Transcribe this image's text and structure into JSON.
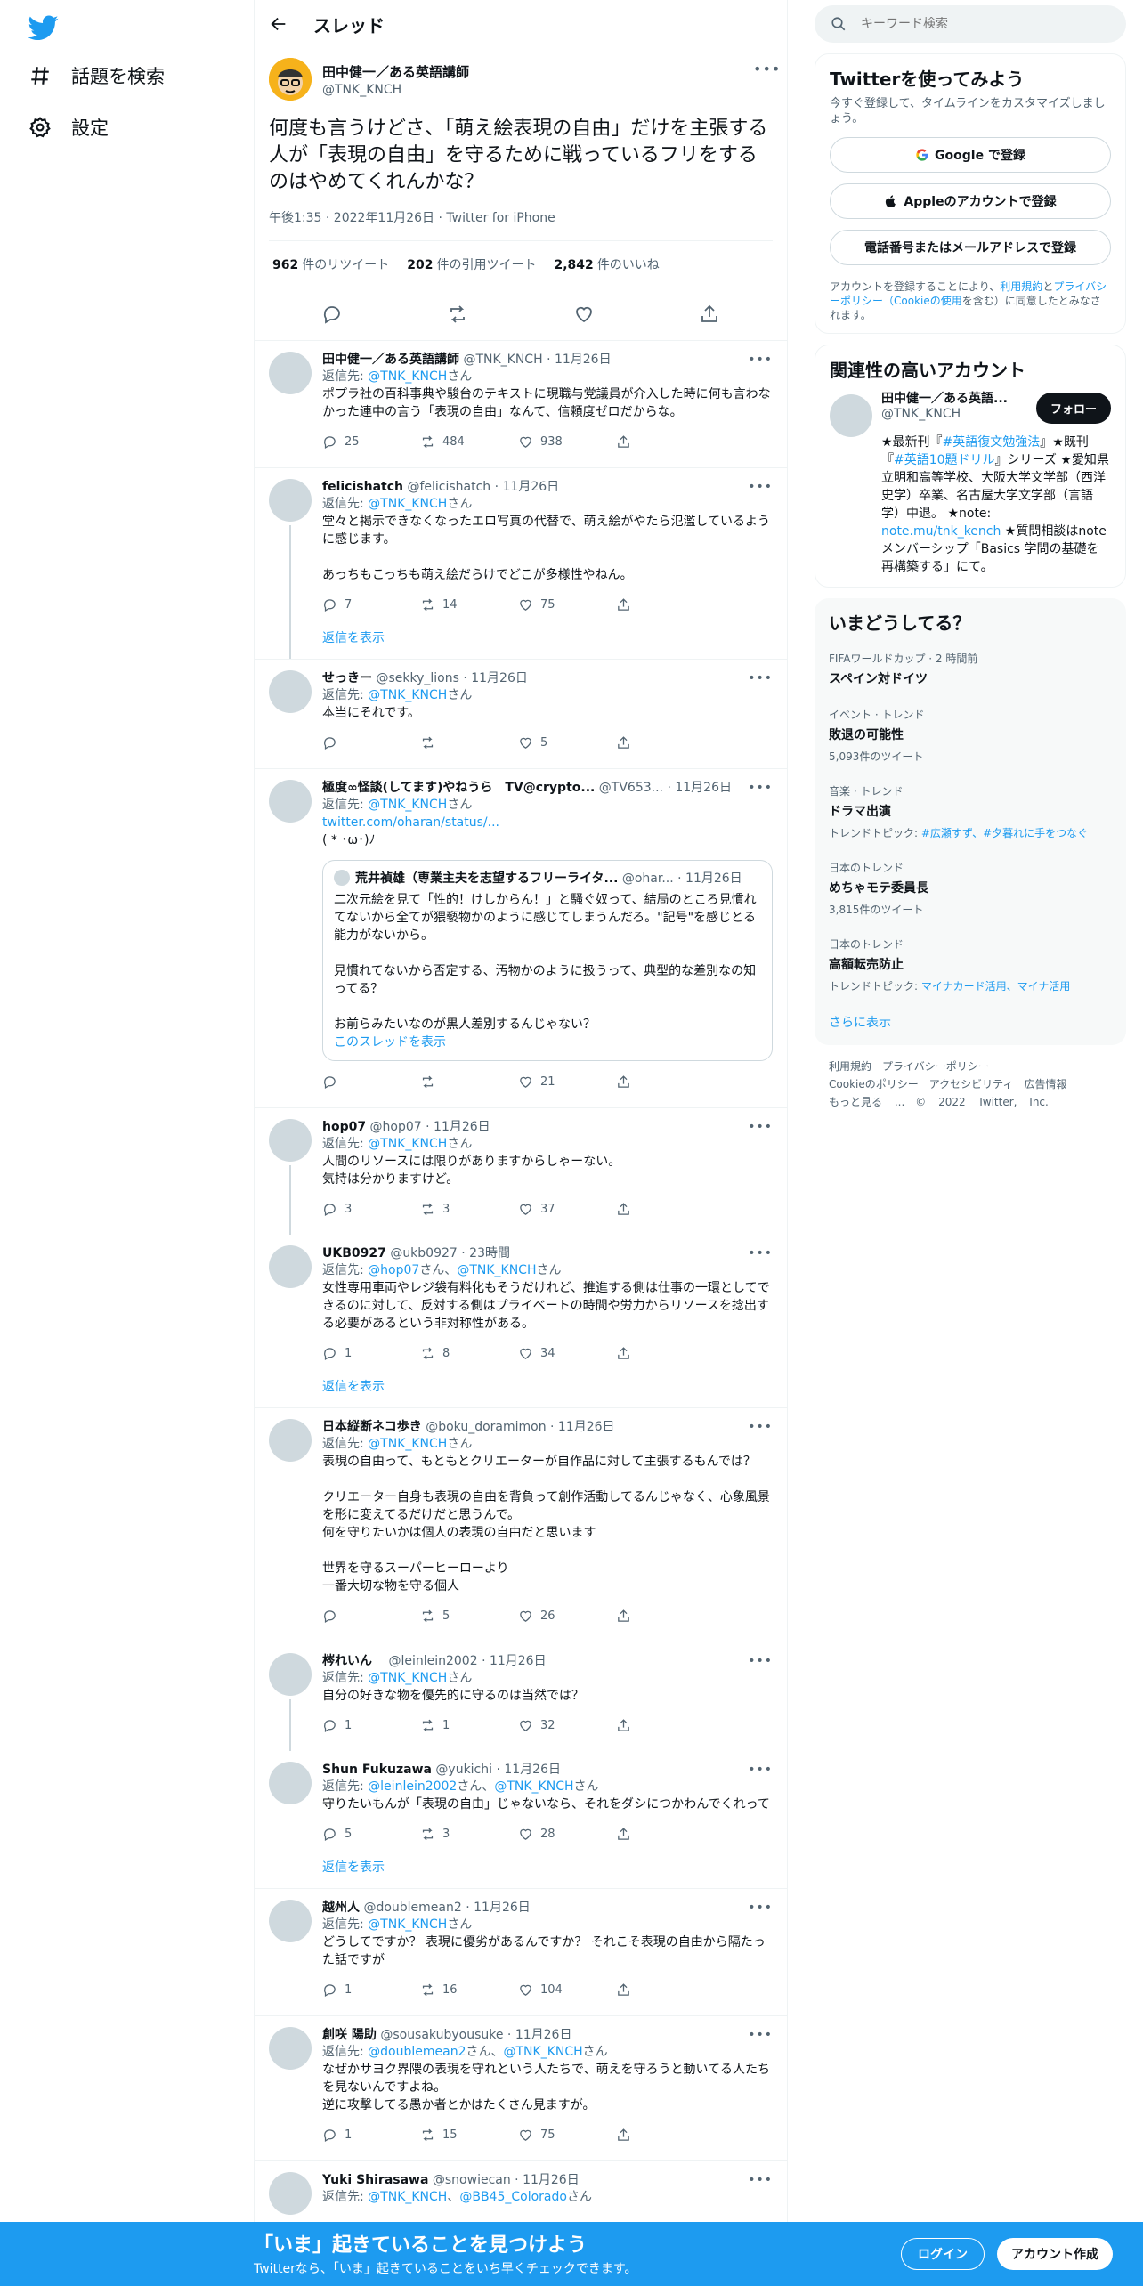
{
  "nav": {
    "explore_label": "話題を検索",
    "settings_label": "設定"
  },
  "header": {
    "title": "スレッド"
  },
  "main_tweet": {
    "name": "田中健一／ある英語講師",
    "handle": "@TNK_KNCH",
    "text": "何度も言うけどさ、「萌え絵表現の自由」だけを主張する人が「表現の自由」を守るために戦っているフリをするのはやめてくれんかな？",
    "meta": "午後1:35 · 2022年11月26日 · Twitter for iPhone",
    "retweets_count": "962",
    "retweets_label": "件のリツイート",
    "quotes_count": "202",
    "quotes_label": "件の引用ツイート",
    "likes_count": "2,842",
    "likes_label": "件のいいね"
  },
  "replies": [
    {
      "name": "田中健一／ある英語講師",
      "meta": "@TNK_KNCH · 11月26日",
      "to_prefix": "返信先: ",
      "to": "@TNK_KNCH",
      "to_suffix": "さん",
      "text": "ポプラ社の百科事典や駿台のテキストに現職与党議員が介入した時に何も言わなかった連中の言う「表現の自由」なんて、信頼度ゼロだからな。",
      "reply": "25",
      "rt": "484",
      "like": "938"
    },
    {
      "name": "felicishatch",
      "meta": "@felicishatch · 11月26日",
      "to_prefix": "返信先: ",
      "to": "@TNK_KNCH",
      "to_suffix": "さん",
      "text": "堂々と掲示できなくなったエロ写真の代替で、萌え絵がやたら氾濫しているように感じます。\n\nあっちもこっちも萌え絵だらけでどこが多様性やねん。",
      "reply": "7",
      "rt": "14",
      "like": "75",
      "show": "返信を表示"
    },
    {
      "name": "せっきー",
      "meta": "@sekky_lions · 11月26日",
      "to_prefix": "返信先: ",
      "to": "@TNK_KNCH",
      "to_suffix": "さん",
      "text": "本当にそれです。",
      "reply": "",
      "rt": "",
      "like": "5"
    },
    {
      "name": "極度∞怪談(してます)やねうら　TV@crypto...",
      "meta": "@TV653... · 11月26日",
      "to_prefix": "返信先: ",
      "to": "@TNK_KNCH",
      "to_suffix": "さん",
      "link": "twitter.com/oharan/status/...",
      "text": "( * ･ω･)ﾉ",
      "quote_name": "荒井禎雄（専業主夫を志望するフリーライタ...",
      "quote_meta": "@ohar... · 11月26日",
      "quote_text": "二次元絵を見て「性的！けしからん！」と騒ぐ奴って、結局のところ見慣れてないから全てが猥褻物かのように感じてしまうんだろ。\"記号\"を感じとる能力がないから。\n\n見慣れてないから否定する、汚物かのように扱うって、典型的な差別なの知ってる？\n\nお前らみたいなのが黒人差別するんじゃない？",
      "quote_link": "このスレッドを表示",
      "reply": "",
      "rt": "",
      "like": "21"
    },
    {
      "name": "hop07",
      "meta": "@hop07 · 11月26日",
      "to_prefix": "返信先: ",
      "to": "@TNK_KNCH",
      "to_suffix": "さん",
      "text": "人間のリソースには限りがありますからしゃーない。\n気持は分かりますけど。",
      "reply": "3",
      "rt": "3",
      "like": "37"
    },
    {
      "name": "UKB0927",
      "meta": "@ukb0927 · 23時間",
      "to_prefix": "返信先: ",
      "to": "@hop07",
      "to_mid": "さん、",
      "to2": "@TNK_KNCH",
      "to_suffix": "さん",
      "text": "女性専用車両やレジ袋有料化もそうだけれど、推進する側は仕事の一環としてできるのに対して、反対する側はプライベートの時間や労力からリソースを捻出する必要があるという非対称性がある。",
      "reply": "1",
      "rt": "8",
      "like": "34",
      "show": "返信を表示"
    },
    {
      "name": "日本縦断ネコ歩き",
      "meta": "@boku_doramimon · 11月26日",
      "to_prefix": "返信先: ",
      "to": "@TNK_KNCH",
      "to_suffix": "さん",
      "text": "表現の自由って、もともとクリエーターが自作品に対して主張するもんでは？\n\nクリエーター自身も表現の自由を背負って創作活動してるんじゃなく、心象風景を形に変えてるだけだと思うんで。\n何を守りたいかは個人の表現の自由だと思います\n\n世界を守るスーパーヒーローより\n一番大切な物を守る個人",
      "reply": "",
      "rt": "5",
      "like": "26"
    },
    {
      "name": "梣れいん",
      "meta": "　@leinlein2002 · 11月26日",
      "to_prefix": "返信先: ",
      "to": "@TNK_KNCH",
      "to_suffix": "さん",
      "text": "自分の好きな物を優先的に守るのは当然では？",
      "reply": "1",
      "rt": "1",
      "like": "32"
    },
    {
      "name": "Shun Fukuzawa",
      "meta": "@yukichi · 11月26日",
      "to_prefix": "返信先: ",
      "to": "@leinlein2002",
      "to_mid": "さん、",
      "to2": "@TNK_KNCH",
      "to_suffix": "さん",
      "text": "守りたいもんが「表現の自由」じゃないなら、それをダシにつかわんでくれって",
      "reply": "5",
      "rt": "3",
      "like": "28",
      "show": "返信を表示"
    },
    {
      "name": "越州人",
      "meta": "@doublemean2 · 11月26日",
      "to_prefix": "返信先: ",
      "to": "@TNK_KNCH",
      "to_suffix": "さん",
      "text": "どうしてですか？ 表現に優劣があるんですか？ それこそ表現の自由から隔たった話ですが",
      "reply": "1",
      "rt": "16",
      "like": "104"
    },
    {
      "name": "創咲 陽助",
      "meta": "@sousakubyousuke · 11月26日",
      "to_prefix": "返信先: ",
      "to": "@doublemean2",
      "to_mid": "さん、",
      "to2": "@TNK_KNCH",
      "to_suffix": "さん",
      "text": "なぜかサヨク界隈の表現を守れという人たちで、萌えを守ろうと動いてる人たちを見ないんですよね。\n逆に攻撃してる愚か者とかはたくさん見ますが。",
      "reply": "1",
      "rt": "15",
      "like": "75"
    },
    {
      "name": "Yuki Shirasawa",
      "meta": "@snowiecan · 11月26日",
      "to_prefix": "返信先: ",
      "to": "@TNK_KNCH",
      "to_mid": "、",
      "to2": "@BB45_Colorado",
      "to_suffix": "さん",
      "text": "",
      "reply": "",
      "rt": "",
      "like": ""
    }
  ],
  "right": {
    "search_placeholder": "キーワード検索",
    "signup": {
      "title": "Twitterを使ってみよう",
      "sub": "今すぐ登録して、タイムラインをカスタマイズしましょう。",
      "google": "Google で登録",
      "apple": "Appleのアカウントで登録",
      "phone": "電話番号またはメールアドレスで登録",
      "legal_1": "アカウントを登録することにより、",
      "legal_terms": "利用規約",
      "legal_2": "と",
      "legal_privacy": "プライバシーポリシー（Cookieの使用",
      "legal_3": "を含む）に同意したとみなされます。"
    },
    "related": {
      "title": "関連性の高いアカウント",
      "name": "田中健一／ある英語...",
      "handle": "@TNK_KNCH",
      "follow": "フォロー",
      "bio_1": "★最新刊『",
      "bio_tag1": "#英語復文勉強法",
      "bio_2": "』★既刊『",
      "bio_tag2": "#英語10題ドリル",
      "bio_3": "』シリーズ ★愛知県立明和高等学校、大阪大学文学部（西洋史学）卒業、名古屋大学文学部（言語学）中退。 ★note: ",
      "bio_link": "note.mu/tnk_kench",
      "bio_4": " ★質問相談はnoteメンバーシップ「Basics 学問の基礎を再構築する」にて。"
    },
    "trends": {
      "title": "いまどうしてる？",
      "items": [
        {
          "cat": "FIFAワールドカップ · 2 時間前",
          "name": "スペイン対ドイツ",
          "cnt": "",
          "topic_label": "",
          "topic": ""
        },
        {
          "cat": "イベント · トレンド",
          "name": "敗退の可能性",
          "cnt": "5,093件のツイート",
          "topic_label": "",
          "topic": ""
        },
        {
          "cat": "音楽 · トレンド",
          "name": "ドラマ出演",
          "cnt": "",
          "topic_label": "トレンドトピック: ",
          "topic": "#広瀬すず、#夕暮れに手をつなぐ"
        },
        {
          "cat": "日本のトレンド",
          "name": "めちゃモテ委員長",
          "cnt": "3,815件のツイート",
          "topic_label": "",
          "topic": ""
        },
        {
          "cat": "日本のトレンド",
          "name": "高額転売防止",
          "cnt": "",
          "topic_label": "トレンドトピック: ",
          "topic": "マイナカード活用、マイナ活用"
        }
      ],
      "more": "さらに表示"
    },
    "footer": {
      "line1": "利用規約　プライバシーポリシー",
      "line2": "Cookieのポリシー　アクセシビリティ　広告情報",
      "line3": "もっと見る ...　© 2022 Twitter, Inc."
    }
  },
  "bottom": {
    "title": "「いま」起きていることを見つけよう",
    "sub": "Twitterなら、「いま」起きていることをいち早くチェックできます。",
    "login": "ログイン",
    "signup": "アカウント作成"
  },
  "colors": {
    "accent": "#1d9bf0",
    "text": "#0f1419",
    "muted": "#536471",
    "border": "#eff3f4"
  }
}
